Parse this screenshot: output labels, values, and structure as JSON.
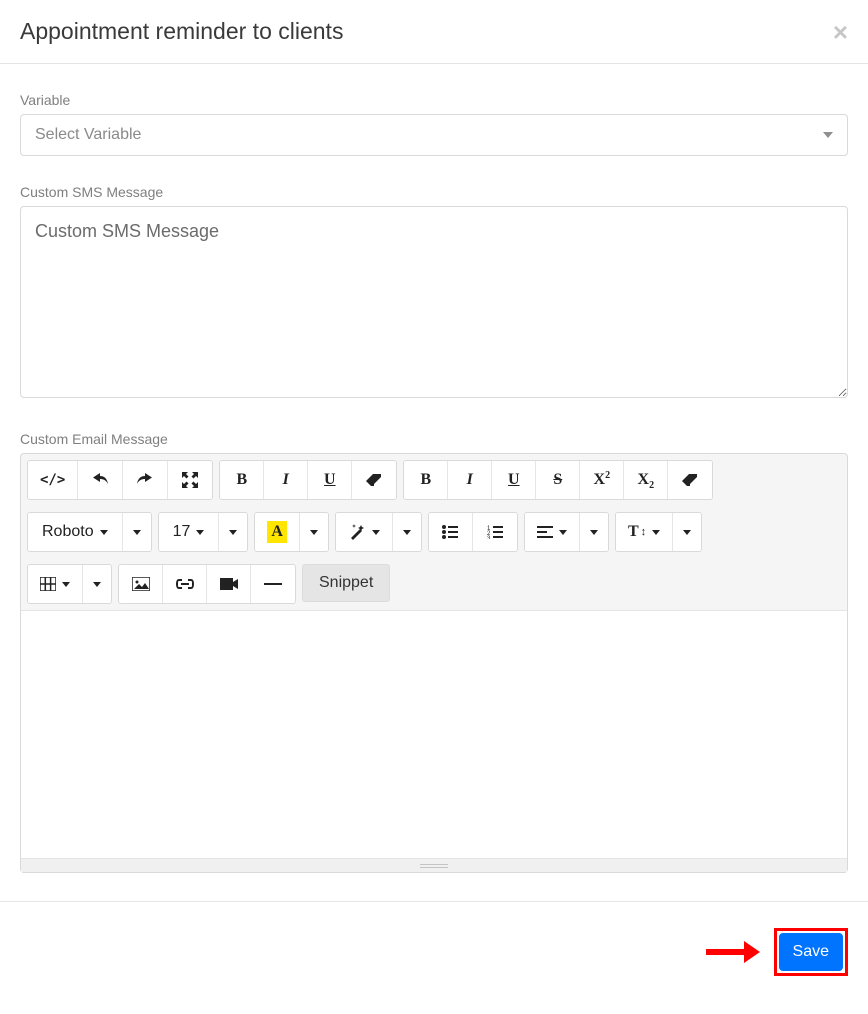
{
  "header": {
    "title": "Appointment reminder to clients",
    "close_symbol": "×"
  },
  "variable": {
    "label": "Variable",
    "placeholder": "Select Variable"
  },
  "sms": {
    "label": "Custom SMS Message",
    "placeholder": "Custom SMS Message"
  },
  "email": {
    "label": "Custom Email Message"
  },
  "toolbar": {
    "font_family": "Roboto",
    "font_size": "17",
    "snippet_label": "Snippet"
  },
  "footer": {
    "save_label": "Save"
  }
}
